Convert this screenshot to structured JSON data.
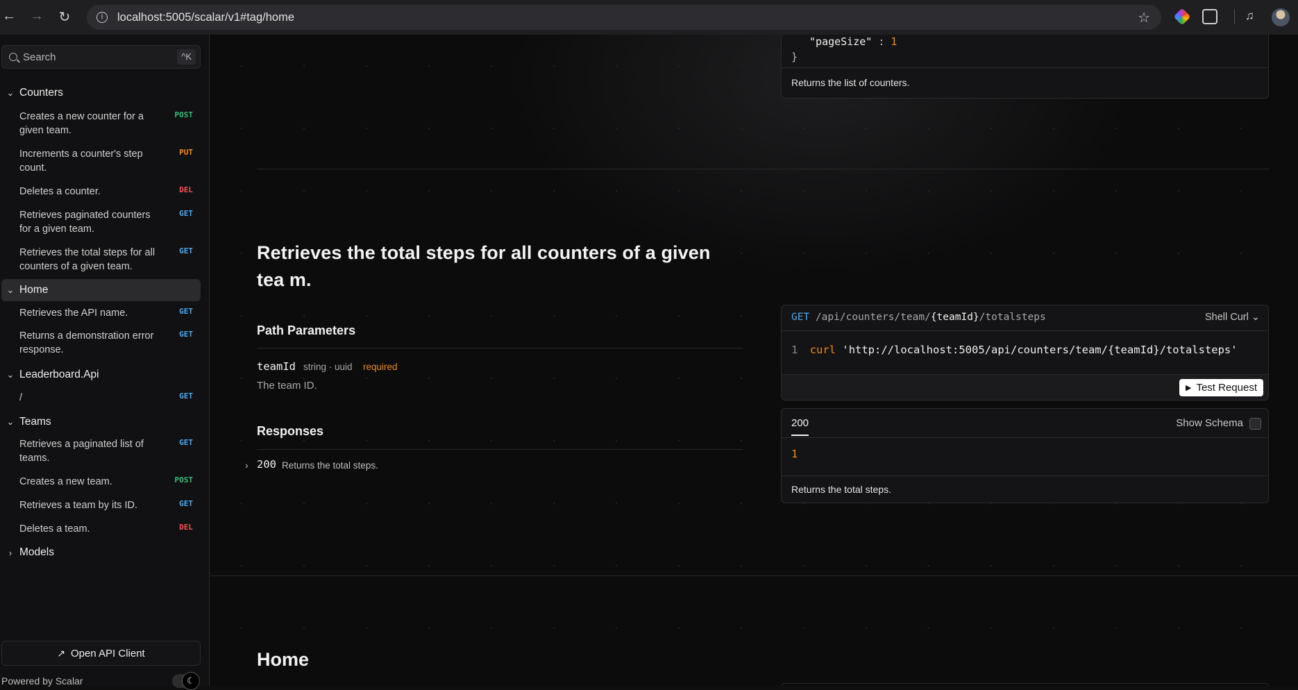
{
  "browser": {
    "url": "localhost:5005/scalar/v1#tag/home",
    "back_icon": "←",
    "forward_icon": "→",
    "reload_icon": "↻",
    "info_icon": "i",
    "star_icon": "☆",
    "media_icon": "♫"
  },
  "sidebar": {
    "search_placeholder": "Search",
    "search_shortcut": "^K",
    "sections": [
      {
        "label": "Counters",
        "chevron": "⌄"
      },
      {
        "label": "Home",
        "chevron": "⌄"
      },
      {
        "label": "Leaderboard.Api",
        "chevron": "⌄"
      },
      {
        "label": "Teams",
        "chevron": "⌄"
      },
      {
        "label": "Models",
        "chevron": "›"
      }
    ],
    "counters_items": [
      {
        "label": "Creates a new counter for a given team.",
        "method": "POST"
      },
      {
        "label": "Increments a counter's step count.",
        "method": "PUT"
      },
      {
        "label": "Deletes a counter.",
        "method": "DEL"
      },
      {
        "label": "Retrieves paginated counters for a given team.",
        "method": "GET"
      },
      {
        "label": "Retrieves the total steps for all counters of a given team.",
        "method": "GET"
      }
    ],
    "home_items": [
      {
        "label": "Retrieves the API name.",
        "method": "GET"
      },
      {
        "label": "Returns a demonstration error response.",
        "method": "GET"
      }
    ],
    "leaderboard_items": [
      {
        "label": "/",
        "method": "GET"
      }
    ],
    "teams_items": [
      {
        "label": "Retrieves a paginated list of teams.",
        "method": "GET"
      },
      {
        "label": "Creates a new team.",
        "method": "POST"
      },
      {
        "label": "Retrieves a team by its ID.",
        "method": "GET"
      },
      {
        "label": "Deletes a team.",
        "method": "DEL"
      }
    ],
    "open_client_label": "Open API Client",
    "open_client_icon": "↗",
    "powered_by": "Powered by Scalar",
    "theme_icon": "☾"
  },
  "main": {
    "top_example": {
      "partial_line_key": "\"pageSize\"",
      "partial_line_colon": ":",
      "partial_line_value": "1",
      "closing_brace": "}",
      "description": "Returns the list of counters."
    },
    "endpoint": {
      "title": "Retrieves the total steps for all counters of a given tea m.",
      "path_params_heading": "Path Parameters",
      "param_name": "teamId",
      "param_type": "string · uuid",
      "param_required": "required",
      "param_description": "The team ID.",
      "responses_heading": "Responses",
      "response_code": "200",
      "response_description": "Returns the total steps.",
      "response_chevron": "›"
    },
    "request_example": {
      "method": "GET",
      "path_prefix": "/api/counters/team/",
      "path_param": "{teamId}",
      "path_suffix": "/totalsteps",
      "language": "Shell Curl",
      "language_chevron": "⌄",
      "line_number": "1",
      "command": "curl",
      "command_url": "'http://localhost:5005/api/counters/team/{teamId}/totalsteps'",
      "test_button": "Test Request",
      "play_icon": "▶"
    },
    "response_example": {
      "tab": "200",
      "show_schema": "Show Schema",
      "value": "1",
      "description": "Returns the total steps."
    },
    "next_section_title": "Home"
  },
  "colors": {
    "accent_get": "#4aa8f3",
    "accent_post": "#3cbd7a",
    "accent_put": "#f08a24",
    "accent_del": "#f05252",
    "required": "#f08a24"
  }
}
